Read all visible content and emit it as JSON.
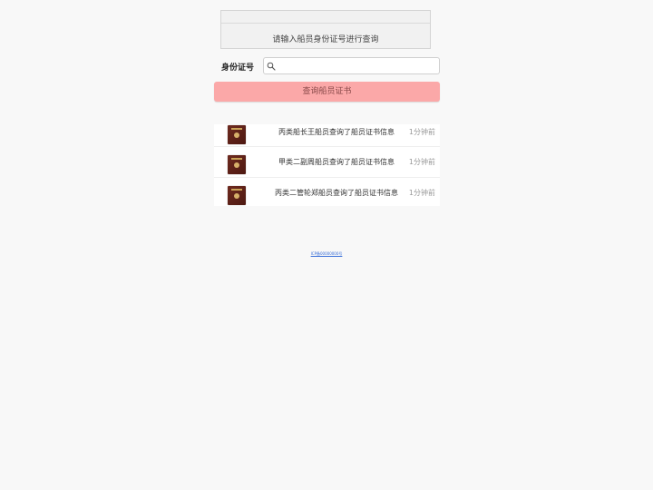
{
  "notice": {
    "text": "请输入船员身份证号进行查询"
  },
  "form": {
    "label": "身份证号",
    "input_value": "",
    "input_placeholder": "",
    "search_icon": "search-icon"
  },
  "query_button": {
    "label": "查询船员证书"
  },
  "feed": {
    "items": [
      {
        "text": "丙类船长王船员查询了船员证书信息",
        "time": "1分钟前",
        "icon": "certificate-icon"
      },
      {
        "text": "甲类二副周船员查询了船员证书信息",
        "time": "1分钟前",
        "icon": "certificate-icon"
      },
      {
        "text": "丙类二管轮郑船员查询了船员证书信息",
        "time": "1分钟前",
        "icon": "certificate-icon"
      }
    ]
  },
  "footer": {
    "link_text": "ICP备00000000号"
  },
  "colors": {
    "button_bg": "#fba8a8",
    "button_text": "#8a4a4a",
    "page_bg": "#f8f8f8",
    "link": "#3a6fd8"
  }
}
